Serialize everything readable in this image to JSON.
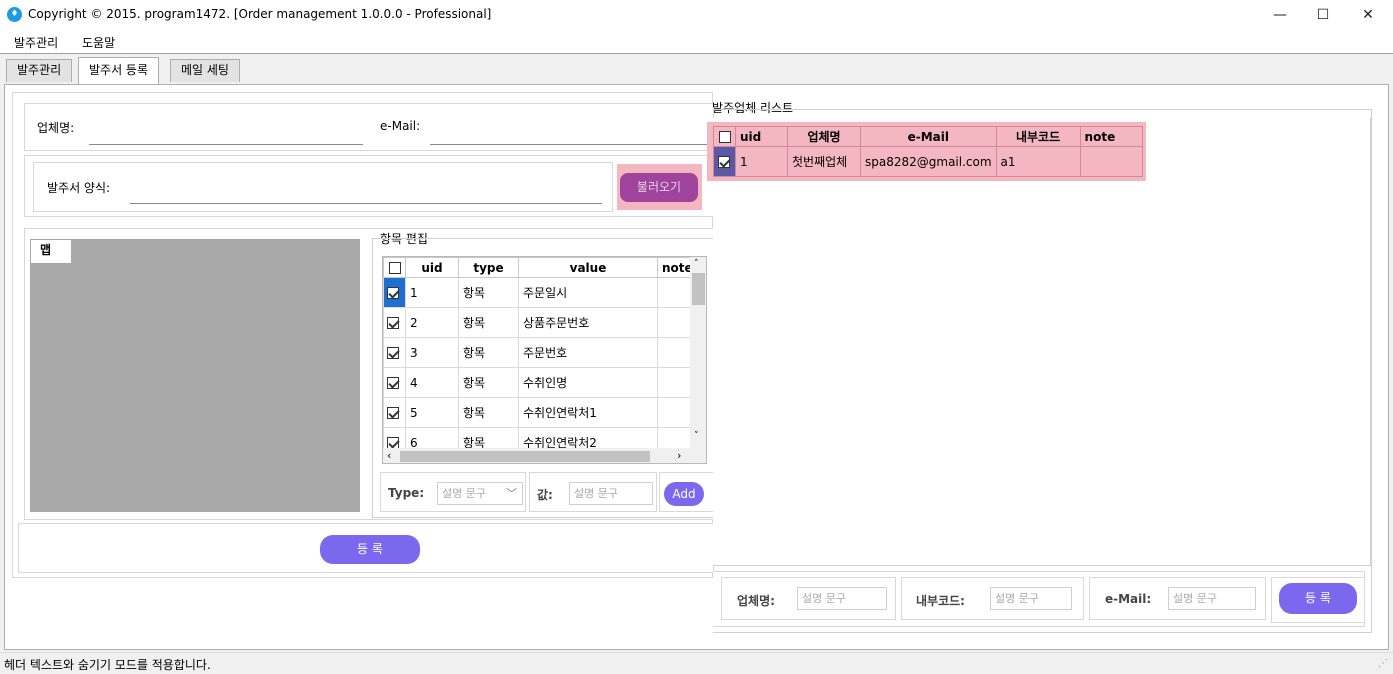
{
  "window": {
    "title": "Copyright © 2015. program1472. [Order management 1.0.0.0 - Professional]",
    "minimize": "—",
    "maximize": "☐",
    "close": "✕"
  },
  "menu": [
    "발주관리",
    "도움말"
  ],
  "tabs": [
    "발주관리",
    "발주서 등록",
    "메일 세팅"
  ],
  "form": {
    "company_label": "업체명:",
    "email_label": "e-Mail:",
    "template_label": "발주서 양식:",
    "load_button": "불러오기"
  },
  "map": {
    "tab_label": "맵"
  },
  "item_edit": {
    "group_title": "항목 편집",
    "columns": [
      "uid",
      "type",
      "value",
      "note"
    ],
    "rows": [
      {
        "uid": "1",
        "type": "항목",
        "value": "주문일시",
        "checked": true
      },
      {
        "uid": "2",
        "type": "항목",
        "value": "상품주문번호",
        "checked": true
      },
      {
        "uid": "3",
        "type": "항목",
        "value": "주문번호",
        "checked": true
      },
      {
        "uid": "4",
        "type": "항목",
        "value": "수취인명",
        "checked": true
      },
      {
        "uid": "5",
        "type": "항목",
        "value": "수취인연락처1",
        "checked": true
      },
      {
        "uid": "6",
        "type": "항목",
        "value": "수취인연락처2",
        "checked": true
      }
    ],
    "type_label": "Type:",
    "type_placeholder": "설명 문구",
    "value_label": "값:",
    "value_placeholder": "설명 문구",
    "add_button": "Add"
  },
  "register_button": "등 록",
  "vendor_list": {
    "group_title": "발주업체 리스트",
    "columns": [
      "uid",
      "업체명",
      "e-Mail",
      "내부코드",
      "note"
    ],
    "rows": [
      {
        "uid": "1",
        "company": "첫번째업체",
        "email": "spa8282@gmail.com",
        "code": "a1",
        "note": "",
        "checked": true
      }
    ],
    "company_label": "업체명:",
    "company_placeholder": "설명 문구",
    "code_label": "내부코드:",
    "code_placeholder": "설명 문구",
    "email_label": "e-Mail:",
    "email_placeholder": "설명 문구",
    "register_button": "등 록"
  },
  "status": "헤더 텍스트와 숨기기 모드를 적용합니다.",
  "colors": {
    "accent_purple": "#7b68ee",
    "load_button": "#a0439c",
    "highlight_pink": "#f4b6c0"
  }
}
